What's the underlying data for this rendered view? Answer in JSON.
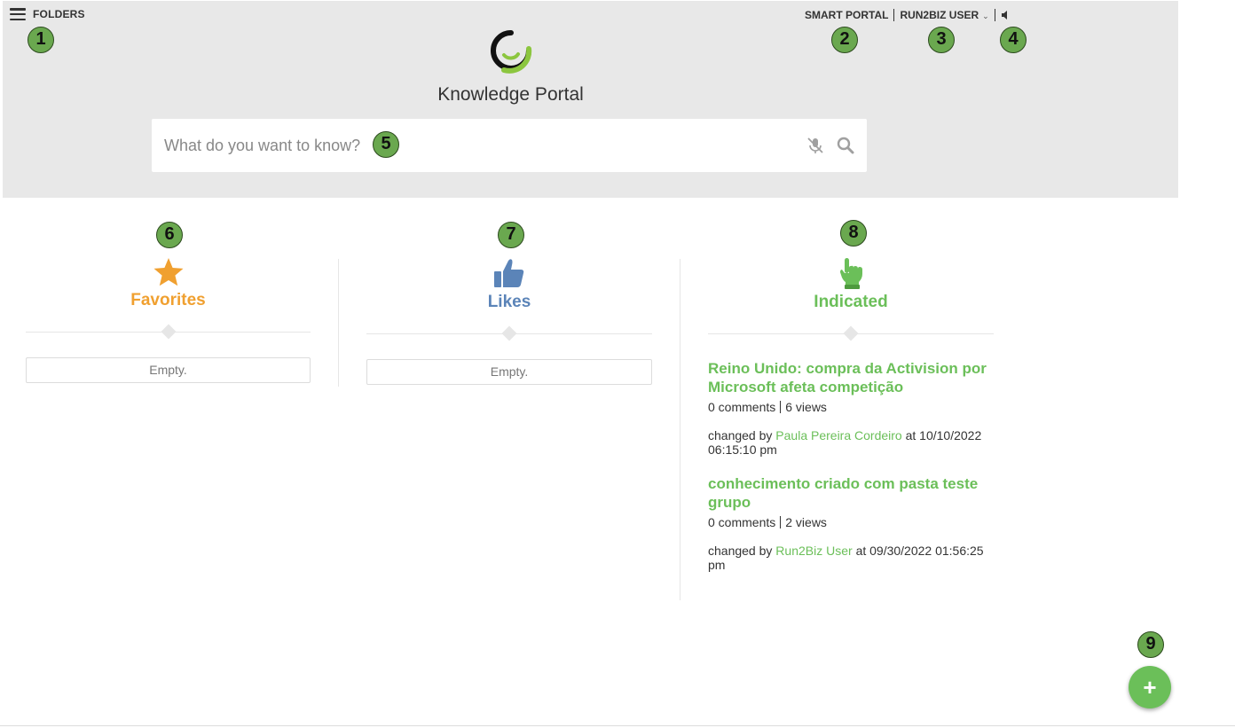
{
  "header": {
    "folders_label": "FOLDERS",
    "nav": {
      "smart_portal": "SMART PORTAL",
      "user": "RUN2BIZ USER",
      "user_chevron": "⌄"
    },
    "title": "Knowledge Portal",
    "search": {
      "placeholder": "What do you want to know?"
    }
  },
  "badges": {
    "b1": "1",
    "b2": "2",
    "b3": "3",
    "b4": "4",
    "b5": "5",
    "b6": "6",
    "b7": "7",
    "b8": "8",
    "b9": "9"
  },
  "columns": {
    "favorites": {
      "title": "Favorites",
      "empty": "Empty.",
      "color": "#f0a030",
      "icon": "star-icon"
    },
    "likes": {
      "title": "Likes",
      "empty": "Empty.",
      "color": "#5b84b8",
      "icon": "thumbs-up-icon"
    },
    "indicated": {
      "title": "Indicated",
      "color": "#6bbf59",
      "icon": "pointing-hand-icon",
      "items": [
        {
          "title": "Reino Unido: compra da Activision por Microsoft afeta competição",
          "comments": "0 comments",
          "views": "6 views",
          "changed_prefix": "changed by",
          "user": "Paula Pereira Cordeiro",
          "changed_suffix": "at 10/10/2022 06:15:10 pm"
        },
        {
          "title": "conhecimento criado com pasta teste grupo",
          "comments": "0 comments",
          "views": "2 views",
          "changed_prefix": "changed by",
          "user": "Run2Biz User",
          "changed_suffix": "at 09/30/2022 01:56:25 pm"
        }
      ]
    }
  },
  "fab": {
    "label": "+"
  },
  "colors": {
    "accent": "#6bbf59",
    "header_bg": "#e8e8e8",
    "badge": "#6aa84f"
  }
}
